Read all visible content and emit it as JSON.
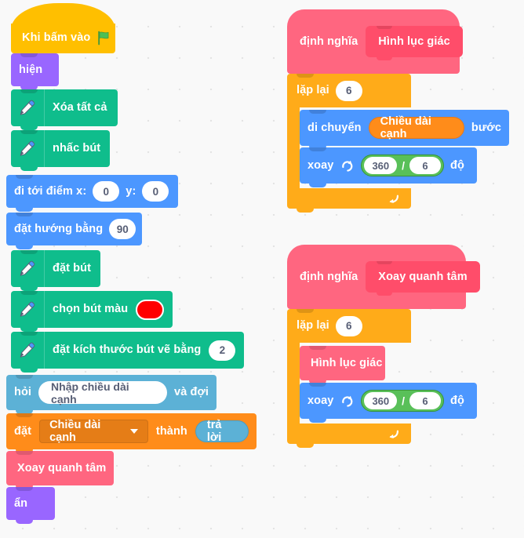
{
  "workspace": {
    "background_color": "#f9f9f9",
    "grid_dot_color": "#e4e4e4"
  },
  "palette": {
    "events": "#ffbf00",
    "looks": "#9966ff",
    "pen": "#0fbd8c",
    "motion": "#4c97ff",
    "sensing": "#5cb1d6",
    "variables": "#ff8c1a",
    "my_blocks": "#ff6680",
    "control": "#ffab19",
    "operators": "#59c059",
    "pen_color_value": "#ff0000"
  },
  "main_script": {
    "hat": {
      "label": "Khi bấm vào",
      "icon": "green-flag-icon"
    },
    "show": {
      "label": "hiện"
    },
    "erase_all": {
      "label": "Xóa tất cả",
      "icon": "pen-icon"
    },
    "pen_up": {
      "label": "nhấc bút",
      "icon": "pen-icon"
    },
    "goto_xy": {
      "label_x": "đi tới điểm x:",
      "x": "0",
      "label_y": "y:",
      "y": "0"
    },
    "point_direction": {
      "label": "đặt hướng bằng",
      "value": "90"
    },
    "pen_down": {
      "label": "đặt bút",
      "icon": "pen-icon"
    },
    "set_pen_color": {
      "label": "chọn bút màu",
      "icon": "pen-icon",
      "color": "#ff0000"
    },
    "set_pen_size": {
      "label": "đặt kích thước bút vẽ bằng",
      "icon": "pen-icon",
      "value": "2"
    },
    "ask_and_wait": {
      "label_pre": "hỏi",
      "question": "Nhập chiều dài cạnh",
      "label_post": "và đợi"
    },
    "set_variable": {
      "label_pre": "đặt",
      "variable": "Chiều dài cạnh",
      "label_mid": "thành",
      "value": "trả lời"
    },
    "call_rotate": {
      "label": "Xoay quanh tâm"
    },
    "hide": {
      "label": "ẩn"
    }
  },
  "definition_hexagon": {
    "define_label": "định nghĩa",
    "name": "Hình lục giác",
    "repeat": {
      "label": "lặp lại",
      "times": "6"
    },
    "move": {
      "label_pre": "di chuyển",
      "variable": "Chiều dài cạnh",
      "label_post": "bước"
    },
    "turn": {
      "label": "xoay",
      "icon": "turn-clockwise-icon",
      "numerator": "360",
      "operator": "/",
      "denominator": "6",
      "unit": "độ"
    },
    "loop_arrow_icon": "loop-arrow-icon"
  },
  "definition_rotate_center": {
    "define_label": "định nghĩa",
    "name": "Xoay quanh tâm",
    "repeat": {
      "label": "lặp lại",
      "times": "6"
    },
    "call": {
      "label": "Hình lục giác"
    },
    "turn": {
      "label": "xoay",
      "icon": "turn-clockwise-icon",
      "numerator": "360",
      "operator": "/",
      "denominator": "6",
      "unit": "độ"
    },
    "loop_arrow_icon": "loop-arrow-icon"
  }
}
